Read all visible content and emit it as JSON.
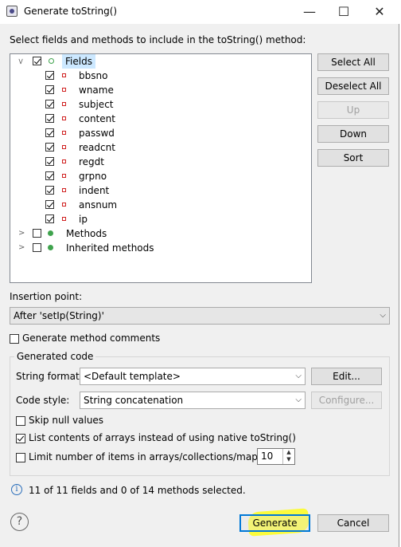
{
  "window": {
    "title": "Generate toString()",
    "minimize": "—",
    "maximize": "☐",
    "close": "✕"
  },
  "instruction": "Select fields and methods to include in the toString() method:",
  "tree": {
    "fields_label": "Fields",
    "fields": [
      "bbsno",
      "wname",
      "subject",
      "content",
      "passwd",
      "readcnt",
      "regdt",
      "grpno",
      "indent",
      "ansnum",
      "ip"
    ],
    "methods_label": "Methods",
    "inherited_label": "Inherited methods"
  },
  "side_buttons": {
    "select_all": "Select All",
    "deselect_all": "Deselect All",
    "up": "Up",
    "down": "Down",
    "sort": "Sort"
  },
  "insertion": {
    "label": "Insertion point:",
    "value": "After 'setIp(String)'"
  },
  "generate_comments": "Generate method comments",
  "generated_code": {
    "title": "Generated code",
    "string_format_label": "String format:",
    "string_format_value": "<Default template>",
    "edit_button": "Edit...",
    "code_style_label": "Code style:",
    "code_style_value": "String concatenation",
    "configure_button": "Configure...",
    "skip_null": "Skip null values",
    "list_arrays": "List contents of arrays instead of using native toString()",
    "limit_items": "Limit number of items in arrays/collections/maps to",
    "limit_value": "10"
  },
  "status": "11 of 11 fields and 0 of 14 methods selected.",
  "footer": {
    "help": "?",
    "generate": "Generate",
    "cancel": "Cancel"
  },
  "colors": {
    "highlight": "#ffff00",
    "selected_bg": "#cce8ff",
    "field_icon": "#d02020",
    "method_dot": "#3fa34d"
  }
}
